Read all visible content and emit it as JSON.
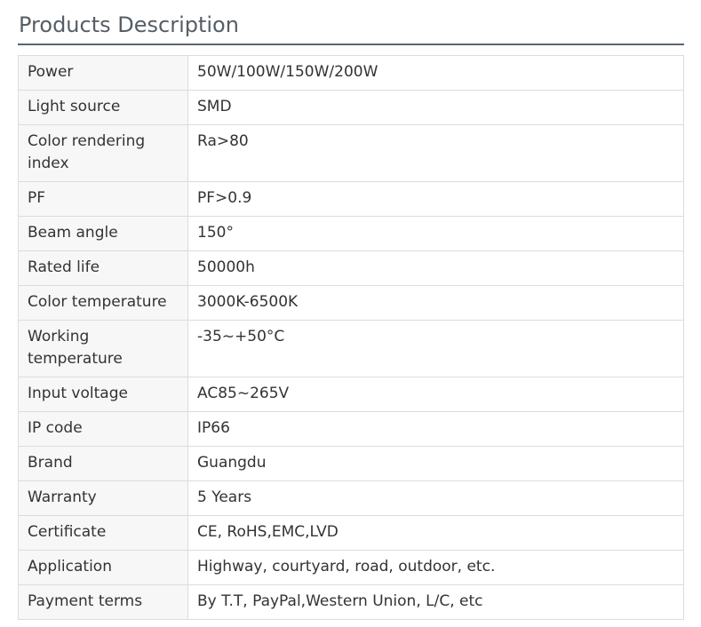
{
  "section": {
    "title": "Products Description"
  },
  "specs": [
    {
      "label": "Power",
      "value": "50W/100W/150W/200W"
    },
    {
      "label": "Light source",
      "value": "SMD"
    },
    {
      "label": "Color rendering index",
      "value": "Ra>80"
    },
    {
      "label": "PF",
      "value": "PF>0.9"
    },
    {
      "label": "Beam angle",
      "value": "150°"
    },
    {
      "label": "Rated life",
      "value": "50000h"
    },
    {
      "label": "Color temperature",
      "value": "3000K-6500K"
    },
    {
      "label": "Working temperature",
      "value": "-35~+50°C"
    },
    {
      "label": "Input voltage",
      "value": "AC85~265V"
    },
    {
      "label": "IP code",
      "value": "IP66"
    },
    {
      "label": "Brand",
      "value": "Guangdu"
    },
    {
      "label": "Warranty",
      "value": "5 Years"
    },
    {
      "label": "Certificate",
      "value": "CE, RoHS,EMC,LVD"
    },
    {
      "label": "Application",
      "value": "Highway, courtyard, road, outdoor, etc."
    },
    {
      "label": "Payment terms",
      "value": "By T.T, PayPal,Western Union, L/C, etc"
    }
  ]
}
